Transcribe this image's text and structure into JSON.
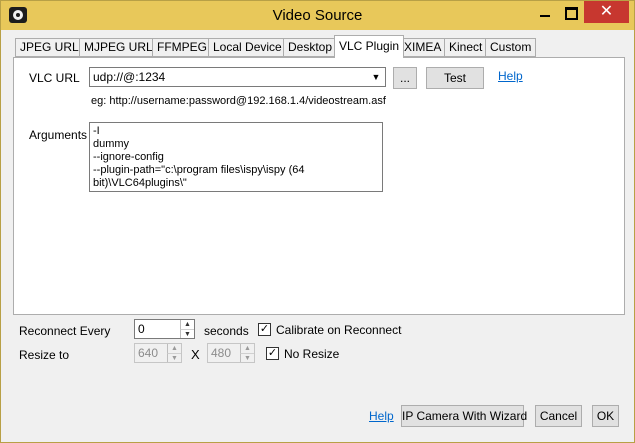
{
  "window": {
    "title": "Video Source",
    "close_glyph": "✕"
  },
  "tabs": [
    {
      "label": "JPEG URL"
    },
    {
      "label": "MJPEG URL"
    },
    {
      "label": "FFMPEG"
    },
    {
      "label": "Local Device"
    },
    {
      "label": "Desktop"
    },
    {
      "label": "VLC Plugin",
      "active": true
    },
    {
      "label": "XIMEA"
    },
    {
      "label": "Kinect"
    },
    {
      "label": "Custom"
    }
  ],
  "vlc": {
    "url_label": "VLC URL",
    "url_value": "udp://@:1234",
    "browse_label": "...",
    "test_label": "Test",
    "help_label": "Help",
    "example_text": "eg: http://username:password@192.168.1.4/videostream.asf",
    "arguments_label": "Arguments",
    "arguments_value": "-I\ndummy\n--ignore-config\n--plugin-path=\"c:\\program files\\ispy\\ispy (64\nbit)\\VLC64plugins\\\""
  },
  "reconnect": {
    "label": "Reconnect Every",
    "value": "0",
    "unit": "seconds",
    "calibrate_label": "Calibrate on Reconnect",
    "calibrate_checked": true
  },
  "resize": {
    "label": "Resize to",
    "width": "640",
    "x_label": "X",
    "height": "480",
    "no_resize_label": "No Resize",
    "no_resize_checked": true
  },
  "footer": {
    "help_label": "Help",
    "wizard_label": "IP Camera With Wizard",
    "cancel_label": "Cancel",
    "ok_label": "OK"
  },
  "check_glyph": "✓",
  "spin_up": "▲",
  "spin_down": "▼",
  "combo_arrow": "▼"
}
